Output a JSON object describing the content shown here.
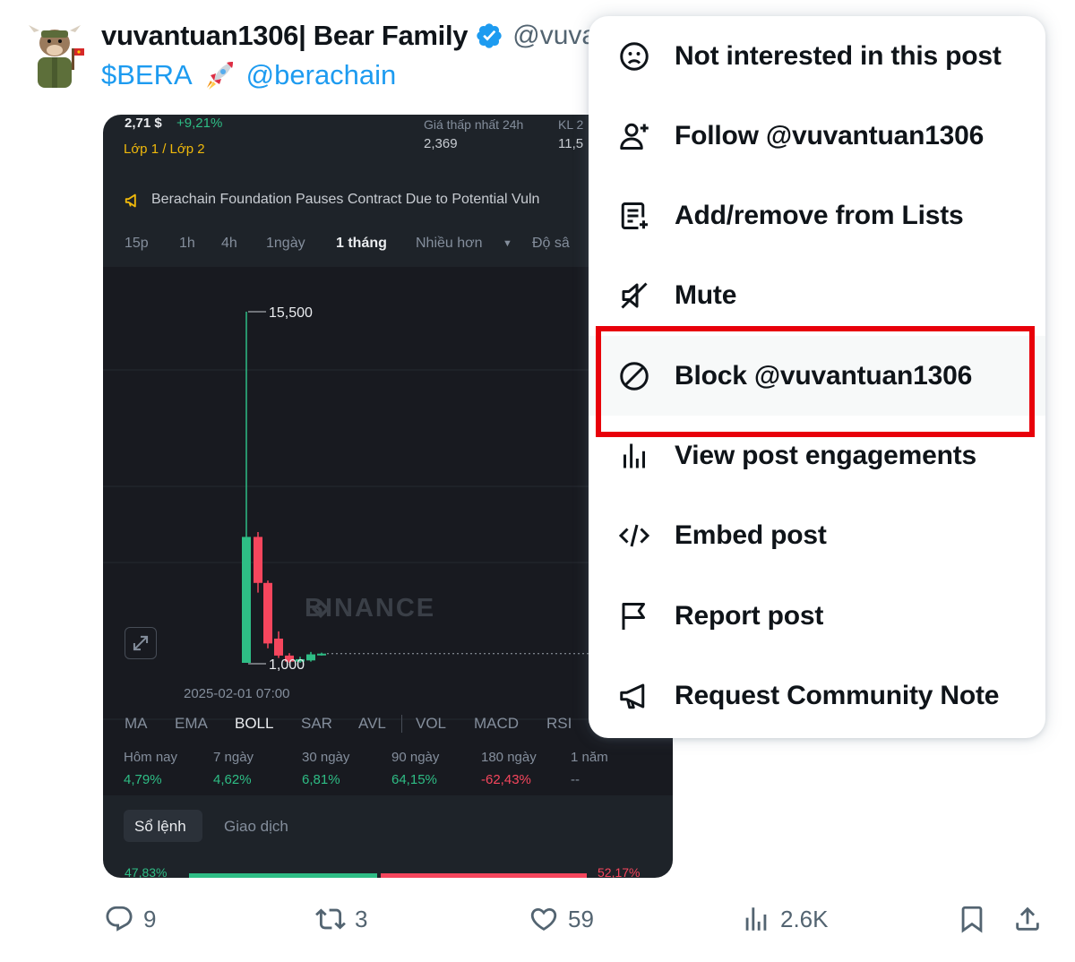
{
  "tweet": {
    "author_name": "vuvantuan1306| Bear Family",
    "author_handle": "@vuva",
    "text_ticker": "$BERA",
    "text_mention": "@berachain"
  },
  "chart_card": {
    "price": "2,71 $",
    "change": "+9,21%",
    "tag": "Lớp 1 / Lớp 2",
    "low_label": "Giá thấp nhất 24h",
    "low_value": "2,369",
    "vol_label": "KL 2",
    "vol_value": "11,5",
    "news": "Berachain Foundation Pauses Contract Due to Potential Vuln",
    "intervals": [
      "15p",
      "1h",
      "4h",
      "1ngày",
      "1 tháng",
      "Nhiều hơn",
      "Độ sâ"
    ],
    "active_interval": "1 tháng",
    "high_marker": "15,500",
    "low_marker": "1,000",
    "watermark": "BINANCE",
    "timestamp": "2025-02-01 07:00",
    "indicators": [
      "MA",
      "EMA",
      "BOLL",
      "SAR",
      "AVL",
      "VOL",
      "MACD",
      "RSI"
    ],
    "active_indicator": "BOLL",
    "stats": [
      {
        "label": "Hôm nay",
        "value": "4,79%"
      },
      {
        "label": "7 ngày",
        "value": "4,62%"
      },
      {
        "label": "30 ngày",
        "value": "6,81%"
      },
      {
        "label": "90 ngày",
        "value": "64,15%"
      },
      {
        "label": "180 ngày",
        "value": "-62,43%"
      },
      {
        "label": "1 năm",
        "value": "--"
      }
    ],
    "tabs": [
      "Sổ lệnh",
      "Giao dịch"
    ],
    "buy_pct": "47,83%",
    "sell_pct": "52,17%"
  },
  "actions": {
    "replies": "9",
    "reposts": "3",
    "likes": "59",
    "views": "2.6K"
  },
  "menu": {
    "items": [
      {
        "label": "Not interested in this post",
        "icon": "frown-icon"
      },
      {
        "label": "Follow @vuvantuan1306",
        "icon": "follow-icon"
      },
      {
        "label": "Add/remove from Lists",
        "icon": "lists-icon"
      },
      {
        "label": "Mute",
        "icon": "mute-icon"
      },
      {
        "label": "Block @vuvantuan1306",
        "icon": "block-icon"
      },
      {
        "label": "View post engagements",
        "icon": "engagements-icon"
      },
      {
        "label": "Embed post",
        "icon": "embed-icon"
      },
      {
        "label": "Report post",
        "icon": "flag-icon"
      },
      {
        "label": "Request Community Note",
        "icon": "megaphone-icon"
      }
    ],
    "highlight_color": "#e8000a"
  },
  "colors": {
    "accent": "#1d9bf0",
    "up": "#2ebd85",
    "down": "#f6465d",
    "card_bg": "#1e2329"
  }
}
